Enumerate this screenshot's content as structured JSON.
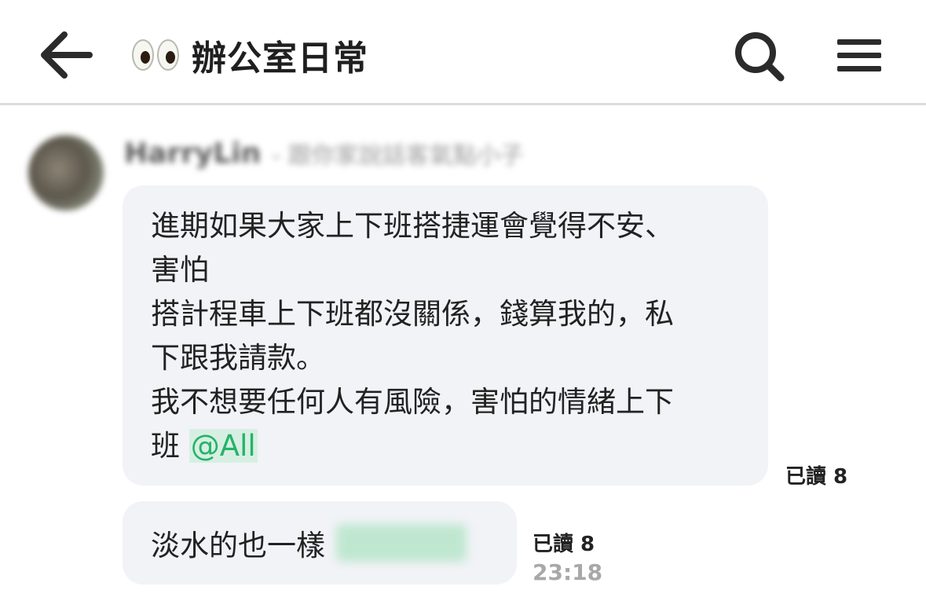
{
  "header": {
    "title": "辦公室日常",
    "title_emoji": "eyes-emoji"
  },
  "chat": {
    "sender": {
      "name": "HarryLin",
      "status": "- 跟你家說話客氣點小子"
    },
    "messages": [
      {
        "lines": [
          "進期如果大家上下班搭捷運會覺得不安、",
          "害怕",
          "搭計程車上下班都沒關係，錢算我的，私",
          "下跟我請款。",
          "我不想要任何人有風險，害怕的情緒上下",
          "班"
        ],
        "mention": "@All",
        "read_label": "已讀 8"
      },
      {
        "text": "淡水的也一樣",
        "mention_blurred": true,
        "read_label": "已讀 8",
        "time": "23:18"
      }
    ]
  },
  "colors": {
    "bubble": "#f2f3f7",
    "mention_text": "#25b36a",
    "mention_bg": "#d7efe2",
    "divider": "#dcdcdc"
  }
}
